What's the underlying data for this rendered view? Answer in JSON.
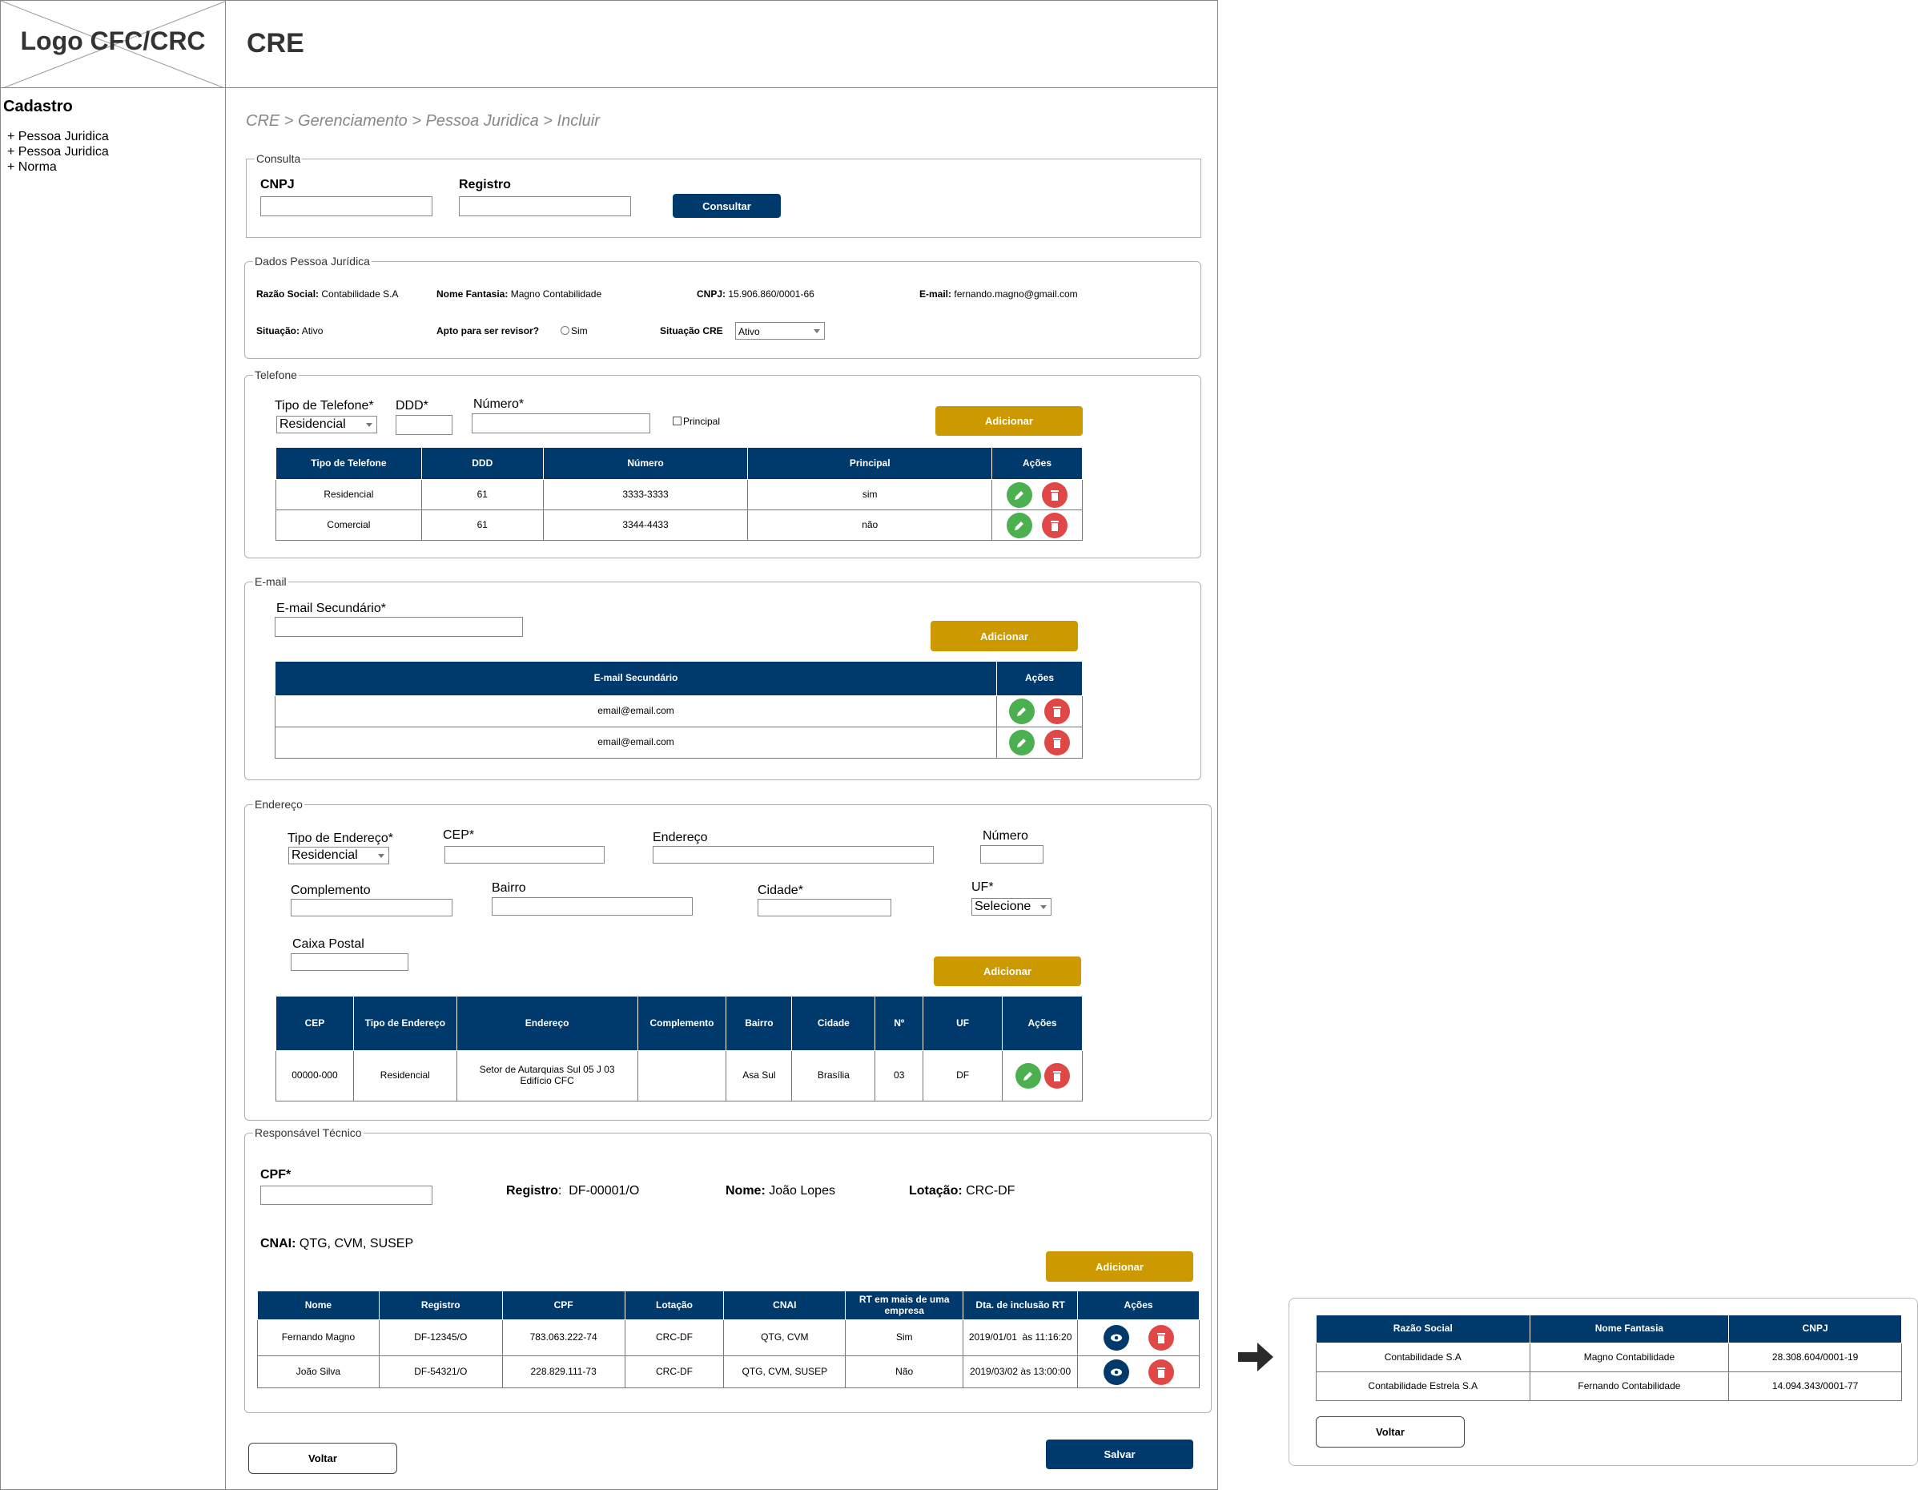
{
  "logo": {
    "text": "Logo CFC/CRC"
  },
  "header": {
    "title": "CRE"
  },
  "sidebar": {
    "title": "Cadastro",
    "items": [
      "+ Pessoa Juridica",
      "+ Pessoa Juridica",
      "+ Norma"
    ]
  },
  "breadcrumb": "CRE > Gerenciamento > Pessoa Juridica > Incluir",
  "consulta": {
    "legend": "Consulta",
    "cnpj_label": "CNPJ",
    "registro_label": "Registro",
    "button": "Consultar"
  },
  "dados": {
    "legend": "Dados Pessoa Jurídica",
    "razao_label": "Razão Social:",
    "razao_value": "Contabilidade S.A",
    "fantasia_label": "Nome Fantasia:",
    "fantasia_value": "Magno Contabilidade",
    "cnpj_label": "CNPJ:",
    "cnpj_value": "15.906.860/0001-66",
    "email_label": "E-mail:",
    "email_value": "fernando.magno@gmail.com",
    "situacao_label": "Situação:",
    "situacao_value": "Ativo",
    "apto_label": "Apto para ser revisor?",
    "apto_option": "Sim",
    "situacao_cre_label": "Situação CRE",
    "situacao_cre_value": "Ativo"
  },
  "telefone": {
    "legend": "Telefone",
    "tipo_label": "Tipo de Telefone*",
    "tipo_value": "Residencial",
    "ddd_label": "DDD*",
    "numero_label": "Número*",
    "principal_label": "Principal",
    "button": "Adicionar",
    "headers": [
      "Tipo de Telefone",
      "DDD",
      "Número",
      "Principal",
      "Ações"
    ],
    "rows": [
      [
        "Residencial",
        "61",
        "3333-3333",
        "sim"
      ],
      [
        "Comercial",
        "61",
        "3344-4433",
        "não"
      ]
    ]
  },
  "email": {
    "legend": "E-mail",
    "label": "E-mail Secundário*",
    "button": "Adicionar",
    "headers": [
      "E-mail Secundário",
      "Ações"
    ],
    "rows": [
      "email@email.com",
      "email@email.com"
    ]
  },
  "endereco": {
    "legend": "Endereço",
    "tipo_label": "Tipo de Endereço*",
    "tipo_value": "Residencial",
    "cep_label": "CEP*",
    "endereco_label": "Endereço",
    "numero_label": "Número",
    "complemento_label": "Complemento",
    "bairro_label": "Bairro",
    "cidade_label": "Cidade*",
    "uf_label": "UF*",
    "uf_value": "Selecione",
    "caixa_label": "Caixa Postal",
    "button": "Adicionar",
    "headers": [
      "CEP",
      "Tipo de Endereço",
      "Endereço",
      "Complemento",
      "Bairro",
      "Cidade",
      "Nº",
      "UF",
      "Ações"
    ],
    "row": [
      "00000-000",
      "Residencial",
      "Setor de Autarquias Sul 05 J 03 Edifício CFC",
      "",
      "Asa Sul",
      "Brasília",
      "03",
      "DF"
    ]
  },
  "responsavel": {
    "legend": "Responsável Técnico",
    "cpf_label": "CPF*",
    "registro_label": "Registro",
    "registro_value": "DF-00001/O",
    "nome_label": "Nome:",
    "nome_value": "João Lopes",
    "lotacao_label": "Lotação:",
    "lotacao_value": "CRC-DF",
    "cnai_label": "CNAI:",
    "cnai_value": "QTG, CVM, SUSEP",
    "button": "Adicionar",
    "headers": [
      "Nome",
      "Registro",
      "CPF",
      "Lotação",
      "CNAI",
      "RT em mais de uma empresa",
      "Dta. de inclusão RT",
      "Ações"
    ],
    "rows": [
      [
        "Fernando Magno",
        "DF-12345/O",
        "783.063.222-74",
        "CRC-DF",
        "QTG, CVM",
        "Sim",
        "2019/01/01  às 11:16:20"
      ],
      [
        "João Silva",
        "DF-54321/O",
        "228.829.111-73",
        "CRC-DF",
        "QTG, CVM, SUSEP",
        "Não",
        "2019/03/02 às 13:00:00"
      ]
    ]
  },
  "footer": {
    "voltar": "Voltar",
    "salvar": "Salvar"
  },
  "popup": {
    "headers": [
      "Razão Social",
      "Nome Fantasia",
      "CNPJ"
    ],
    "rows": [
      [
        "Contabilidade S.A",
        "Magno Contabilidade",
        "28.308.604/0001-19"
      ],
      [
        "Contabilidade Estrela S.A",
        "Fernando Contabilidade",
        "14.094.343/0001-77"
      ]
    ],
    "voltar": "Voltar"
  },
  "colors": {
    "primary": "#003a6c",
    "gold": "#cc9900",
    "edit": "#4caf50",
    "delete": "#e04848"
  },
  "icons": [
    "pencil-icon",
    "trash-icon",
    "eye-icon",
    "arrow-right-icon"
  ]
}
